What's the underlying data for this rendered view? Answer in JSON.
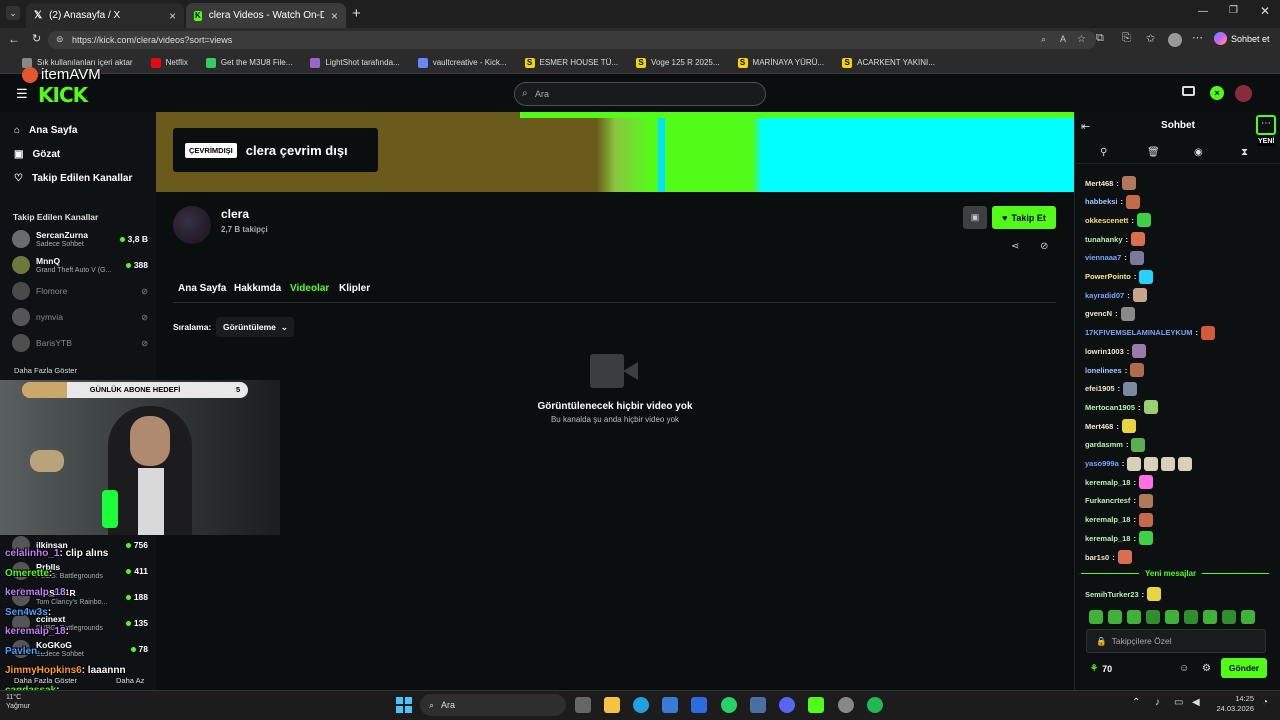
{
  "browser": {
    "tabs": [
      {
        "label": "(2) Anasayfa / X"
      },
      {
        "label": "clera Videos - Watch On-Demand"
      }
    ],
    "url": "https://kick.com/clera/videos?sort=views",
    "profile_button": "Sohbet et",
    "add_tab": "+"
  },
  "bookmarks": [
    {
      "label": "Sık kullanılanları içeri aktar",
      "color": "#888888"
    },
    {
      "label": "Netflix",
      "color": "#e50914"
    },
    {
      "label": "Get the M3U8 File...",
      "color": "#33cc66"
    },
    {
      "label": "LightShot tarafında...",
      "color": "#9966cc"
    },
    {
      "label": "vaultcreative - Kick...",
      "color": "#6688ff"
    },
    {
      "label": "ESMER HOUSE TÜ...",
      "color": "#f2d600"
    },
    {
      "label": "Voge 125 R 2025...",
      "color": "#f2d600"
    },
    {
      "label": "MARİNAYA YÜRÜ...",
      "color": "#f2d600"
    },
    {
      "label": "ACARKENT YAKINI...",
      "color": "#f2d600"
    }
  ],
  "overlay_brand": "itemAVM",
  "header": {
    "logo": "KICK",
    "search_placeholder": "Ara"
  },
  "sidebar": {
    "nav": [
      {
        "label": "Ana Sayfa",
        "icon": "home-icon"
      },
      {
        "label": "Gözat",
        "icon": "browse-icon"
      },
      {
        "label": "Takip Edilen Kanallar",
        "icon": "heart-icon"
      }
    ],
    "followed_title": "Takip Edilen Kanallar",
    "followed": [
      {
        "name": "SercanZurna",
        "sub": "Sadece Sohbet",
        "viewers": "3,8 B",
        "live": true
      },
      {
        "name": "MnnQ",
        "sub": "Grand Theft Auto V (G...",
        "viewers": "388",
        "live": true
      },
      {
        "name": "Flomore",
        "sub": "",
        "viewers": "",
        "live": false
      },
      {
        "name": "nymvia",
        "sub": "",
        "viewers": "",
        "live": false
      },
      {
        "name": "BarisYTB",
        "sub": "",
        "viewers": "",
        "live": false
      }
    ],
    "show_more": "Daha Fazla Göster",
    "recommended": [
      {
        "name": "ilkinsan",
        "sub": "",
        "viewers": "756"
      },
      {
        "name": "Rrblls",
        "sub": "PUBG: Battlegrounds",
        "viewers": "411"
      },
      {
        "name": "MASIKAR",
        "sub": "Tom Clancy's Rainbo...",
        "viewers": "188"
      },
      {
        "name": "ccinext",
        "sub": "PUBG: Battlegrounds",
        "viewers": "135"
      },
      {
        "name": "KoGKoG",
        "sub": "Sadece Sohbet",
        "viewers": "78"
      }
    ],
    "show_more2": "Daha Fazla Göster",
    "show_less": "Daha Az"
  },
  "banner": {
    "offline_badge": "ÇEVRİMDIŞI",
    "offline_text": "clera çevrim dışı"
  },
  "channel": {
    "name": "clera",
    "followers": "2,7 B takipçi",
    "follow_button": "Takip Et"
  },
  "channel_tabs": [
    "Ana Sayfa",
    "Hakkımda",
    "Videolar",
    "Klipler"
  ],
  "sort": {
    "label": "Sıralama:",
    "value": "Görüntüleme"
  },
  "empty": {
    "title": "Görüntülenecek hiçbir video yok",
    "subtitle": "Bu kanalda şu anda hiçbir video yok"
  },
  "sub_goal": {
    "label": "GÜNLÜK ABONE HEDEFİ",
    "count": "5",
    "progress": 0.2
  },
  "overlay_chat": [
    {
      "user": "celalinho_1",
      "text": ": clip alıns",
      "color": "#c77dff"
    },
    {
      "user": "Omerette",
      "text": ":",
      "color": "#53fc18"
    },
    {
      "user": "keremalp_18",
      "text": ":",
      "color": "#c77dff"
    },
    {
      "user": "Sen4w3s",
      "text": ":",
      "color": "#4aa3ff"
    },
    {
      "user": "keremalp_18",
      "text": ":",
      "color": "#c77dff"
    },
    {
      "user": "Pavlen...",
      "text": "",
      "color": "#4aa3ff"
    },
    {
      "user": "JimmyHopkins6",
      "text": ": laaannn",
      "color": "#ff9f1a"
    },
    {
      "user": "cagdassak",
      "text": ":",
      "color": "#53fc18"
    },
    {
      "user": "Neazdy",
      "text": ":",
      "color": "#ffd21f"
    }
  ],
  "chat": {
    "title": "Sohbet",
    "new_label": "YENİ",
    "messages": [
      {
        "user": "Mert468",
        "color": "#f1e8c4"
      },
      {
        "user": "habbeksi",
        "color": "#9fc9ff"
      },
      {
        "user": "okkescenett",
        "color": "#ffdb70"
      },
      {
        "user": "tunahanky",
        "color": "#b5f2b0"
      },
      {
        "user": "viennaaa7",
        "color": "#7aa4ff"
      },
      {
        "user": "PowerPointo",
        "color": "#ffe68a"
      },
      {
        "user": "kayradid07",
        "color": "#7aa4ff"
      },
      {
        "user": "gvencN",
        "color": "#f1e8c4"
      },
      {
        "user": "17KFIVEMSELAMINALEYKUM",
        "color": "#7aa4ff"
      },
      {
        "user": "lowrin1003",
        "color": "#f1e8c4"
      },
      {
        "user": "lonelinees",
        "color": "#9fc9ff"
      },
      {
        "user": "efei1905",
        "color": "#f1e8c4"
      },
      {
        "user": "Mertocan1905",
        "color": "#b5f2b0"
      },
      {
        "user": "Mert468",
        "color": "#f1e8c4"
      },
      {
        "user": "gardasmm",
        "color": "#b5f2b0"
      },
      {
        "user": "yaso999a",
        "color": "#7aa4ff"
      },
      {
        "user": "keremalp_18",
        "color": "#b5f2b0"
      },
      {
        "user": "Furkancrtesf",
        "color": "#b5f2b0"
      },
      {
        "user": "keremalp_18",
        "color": "#b5f2b0"
      },
      {
        "user": "keremalp_18",
        "color": "#b5f2b0"
      },
      {
        "user": "bar1s0",
        "color": "#f1e8c4"
      }
    ],
    "new_messages": "Yeni mesajlar",
    "last": {
      "user": "SemihTurker23",
      "color": "#b5f2b0"
    },
    "input_placeholder": "Takipçilere Özel",
    "points": "70",
    "send": "Gönder"
  },
  "taskbar": {
    "search": "Ara",
    "weather_temp": "11°C",
    "weather_desc": "Yağmur",
    "time": "14:25",
    "date": "24.03.2026"
  }
}
